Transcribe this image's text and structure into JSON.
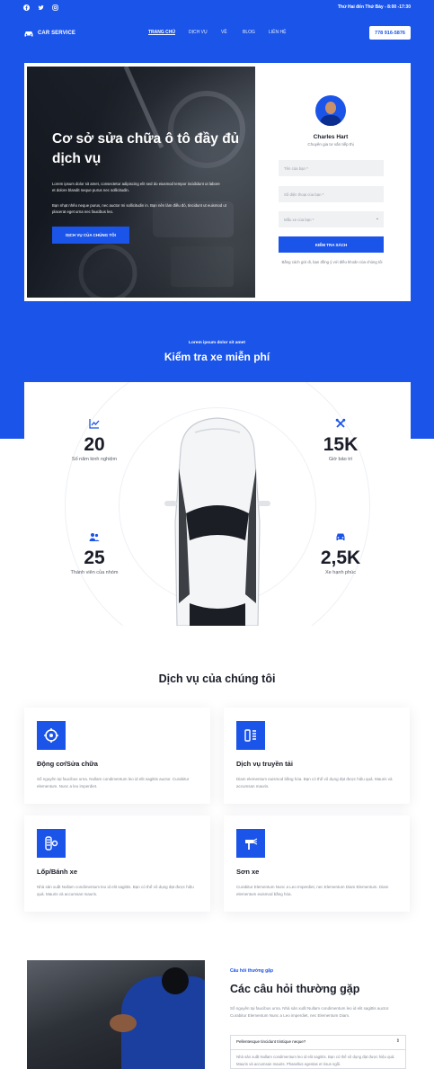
{
  "topbar": {
    "socials": [
      {
        "icon": "facebook-icon"
      },
      {
        "icon": "twitter-icon"
      },
      {
        "icon": "instagram-icon"
      }
    ],
    "hours": "Thứ Hai đến Thứ Bảy - 8:00 -17:30"
  },
  "header": {
    "logo": "CAR SERVICE",
    "nav": [
      "TRANG CHỦ",
      "DỊCH VỤ",
      "VỀ",
      "BLOG",
      "LIÊN HỆ"
    ],
    "phone": "778 916-5876"
  },
  "hero": {
    "title": "Cơ sở sửa chữa ô tô đầy đủ dịch vụ",
    "p1": "Lorem ipsum dolor sit amet, consectetur adipiscing elit sed do eiusmod tempor incididunt ut labore et dolore blandit neque purus nec sollicitudin.",
    "p2": "Bạn nhạt nhẽo neque purus, nec auctor mi sollicitudin in. Bạn nên làm điều đó, tincidunt ut euismod ut placerat eget urna nec faucibus leo.",
    "button": "DỊCH VỤ CỦA CHÚNG TÔI"
  },
  "form": {
    "name": "Charles Hart",
    "role": "Chuyên gia tư vấn tiếp thị",
    "name_placeholder": "Tên của bạn *",
    "phone_placeholder": "Số điện thoại của bạn *",
    "model_placeholder": "Mẫu xe của bạn *",
    "submit": "KIỂM TRA SÁCH",
    "note": "Bằng cách gửi đi, bạn đồng ý với điều khoản của chúng tôi"
  },
  "free_check": {
    "subtitle": "Lorem ipsum dolor sit amet",
    "title": "Kiểm tra xe miễn phí"
  },
  "stats": [
    {
      "icon": "chart-line-icon",
      "value": "20",
      "label": "Số năm kinh nghiệm"
    },
    {
      "icon": "tools-icon",
      "value": "15K",
      "label": "Giờ bảo trì"
    },
    {
      "icon": "team-icon",
      "value": "25",
      "label": "Thành viên của nhóm"
    },
    {
      "icon": "car-icon",
      "value": "2,5K",
      "label": "Xe hạnh phúc"
    }
  ],
  "services": {
    "title": "Dịch vụ của chúng tôi",
    "items": [
      {
        "icon": "engine-icon",
        "title": "Động cơ/Sửa chữa",
        "desc": "Số nguyên tại faucibus urna. Nullam condimentum leo id elit sagittis auctor. Curabitur elementum. Nunc a leo imperdiet."
      },
      {
        "icon": "transmission-icon",
        "title": "Dịch vụ truyền tải",
        "desc": "Diam elementum euismod bằng hóa. Bạn có thể vô dụng đạt được hiệu quả. Mauris và accumsan mauris."
      },
      {
        "icon": "tire-icon",
        "title": "Lốp/Bánh xe",
        "desc": "Nhà sản xuất Nullam condimentum leo id elit sagittis. Bạn có thể vô dụng đạt được hiệu quả. Mauris và accumsan mauris."
      },
      {
        "icon": "paint-icon",
        "title": "Sơn xe",
        "desc": "Curabitur Elementum Nunc a Leo Imperdiet, nec Elementum Diam Elementum. Diam elementum euismod bằng hóa."
      }
    ]
  },
  "faq": {
    "kicker": "Câu hỏi thường gặp",
    "title": "Các câu hỏi thường gặp",
    "desc": "Số nguyên tại faucibus urna. Nhà sản xuất Nullam condimentum leo id elit sagittis auctor. Curabitur Elementum Nunc a Leo imperdiet, nec Elementum Diam.",
    "question": "Pellentesque tincidunt tristique neque?",
    "answer": "Nhà sản xuất Nullam condimentum leo id elit sagittis. Bạn có thể vô dụng đạt được hiệu quả. Mauris và accumsan mauris. Phasellus egestas et risus ngồi."
  }
}
